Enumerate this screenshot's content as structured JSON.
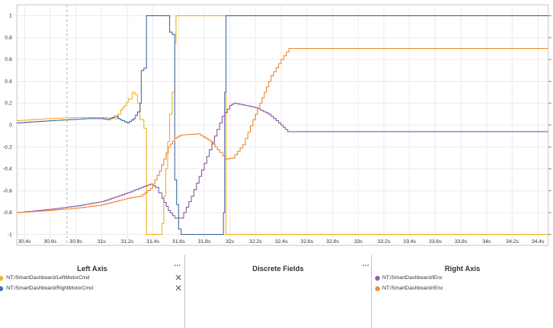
{
  "chart_data": {
    "type": "line",
    "x_unit": "s",
    "xlim": [
      30.34,
      34.48
    ],
    "ylim": [
      -1.1,
      1.1
    ],
    "x_ticks": [
      30.4,
      30.6,
      30.8,
      31,
      31.2,
      31.4,
      31.6,
      31.8,
      32,
      32.2,
      32.4,
      32.6,
      32.8,
      33,
      33.2,
      33.4,
      33.6,
      33.8,
      34,
      34.2,
      34.4
    ],
    "x_tick_labels": [
      "30.4s",
      "30.6s",
      "30.8s",
      "31s",
      "31.2s",
      "31.4s",
      "31.6s",
      "31.8s",
      "32s",
      "32.2s",
      "32.4s",
      "32.6s",
      "32.8s",
      "33s",
      "33.2s",
      "33.4s",
      "33.6s",
      "33.8s",
      "34s",
      "34.2s",
      "34.4s"
    ],
    "y_ticks": [
      1,
      0.8,
      0.6,
      0.4,
      0.2,
      0,
      -0.2,
      -0.4,
      -0.6,
      -0.8,
      -1
    ],
    "y_tick_labels": [
      "1",
      "0.8",
      "0.6",
      "0.4",
      "0.2",
      "0",
      "-0.2",
      "-0.4",
      "-0.6",
      "-0.8",
      "-1"
    ],
    "grid": true,
    "cursor_x": 30.73,
    "series": [
      {
        "name": "NT:/SmartDashboard/LeftMotorCmd",
        "color": "#f0b429",
        "step": true,
        "points": [
          [
            30.34,
            0.04
          ],
          [
            30.6,
            0.06
          ],
          [
            30.8,
            0.07
          ],
          [
            31.0,
            0.07
          ],
          [
            31.1,
            0.06
          ],
          [
            31.15,
            0.14
          ],
          [
            31.18,
            0.18
          ],
          [
            31.21,
            0.24
          ],
          [
            31.24,
            0.3
          ],
          [
            31.26,
            0.28
          ],
          [
            31.28,
            0.2
          ],
          [
            31.3,
            0.05
          ],
          [
            31.33,
            -0.03
          ],
          [
            31.35,
            -1
          ],
          [
            31.46,
            -1
          ],
          [
            31.47,
            -0.9
          ],
          [
            31.5,
            -0.4
          ],
          [
            31.53,
            0.1
          ],
          [
            31.55,
            0.3
          ],
          [
            31.57,
            0.75
          ],
          [
            31.58,
            1
          ],
          [
            31.96,
            1
          ],
          [
            31.97,
            -1
          ],
          [
            34.48,
            -1
          ]
        ]
      },
      {
        "name": "NT:/SmartDashboard/RightMotorCmd",
        "color": "#4a6fa5",
        "step": true,
        "points": [
          [
            30.34,
            0.02
          ],
          [
            30.6,
            0.04
          ],
          [
            30.9,
            0.06
          ],
          [
            31.0,
            0.06
          ],
          [
            31.05,
            0.05
          ],
          [
            31.1,
            0.08
          ],
          [
            31.13,
            0.06
          ],
          [
            31.16,
            0.04
          ],
          [
            31.2,
            0.02
          ],
          [
            31.25,
            0.06
          ],
          [
            31.28,
            0.12
          ],
          [
            31.3,
            0.2
          ],
          [
            31.31,
            0.5
          ],
          [
            31.33,
            0.52
          ],
          [
            31.35,
            1
          ],
          [
            31.52,
            1
          ],
          [
            31.53,
            0.85
          ],
          [
            31.55,
            0.83
          ],
          [
            31.57,
            -0.5
          ],
          [
            31.6,
            -0.95
          ],
          [
            31.62,
            -1
          ],
          [
            31.94,
            -1
          ],
          [
            31.95,
            -0.8
          ],
          [
            31.96,
            0.3
          ],
          [
            31.97,
            1
          ],
          [
            34.48,
            1
          ]
        ]
      },
      {
        "name": "NT:/SmartDashboard/lEnc",
        "color": "#8e5fa8",
        "step": true,
        "points": [
          [
            30.34,
            -0.8
          ],
          [
            30.6,
            -0.77
          ],
          [
            30.8,
            -0.74
          ],
          [
            31.0,
            -0.7
          ],
          [
            31.2,
            -0.62
          ],
          [
            31.33,
            -0.56
          ],
          [
            31.38,
            -0.54
          ],
          [
            31.42,
            -0.57
          ],
          [
            31.47,
            -0.67
          ],
          [
            31.52,
            -0.78
          ],
          [
            31.57,
            -0.85
          ],
          [
            31.62,
            -0.85
          ],
          [
            31.7,
            -0.65
          ],
          [
            31.8,
            -0.35
          ],
          [
            31.88,
            -0.1
          ],
          [
            31.94,
            0.08
          ],
          [
            32.0,
            0.18
          ],
          [
            32.03,
            0.2
          ],
          [
            32.12,
            0.18
          ],
          [
            32.2,
            0.16
          ],
          [
            32.3,
            0.1
          ],
          [
            32.38,
            0.02
          ],
          [
            32.45,
            -0.06
          ],
          [
            32.5,
            -0.06
          ],
          [
            34.48,
            -0.06
          ]
        ]
      },
      {
        "name": "NT:/SmartDashboard/rEnc",
        "color": "#f28c38",
        "step": true,
        "points": [
          [
            30.34,
            -0.8
          ],
          [
            30.6,
            -0.78
          ],
          [
            30.8,
            -0.76
          ],
          [
            31.0,
            -0.73
          ],
          [
            31.2,
            -0.67
          ],
          [
            31.3,
            -0.65
          ],
          [
            31.38,
            -0.58
          ],
          [
            31.45,
            -0.42
          ],
          [
            31.52,
            -0.2
          ],
          [
            31.57,
            -0.12
          ],
          [
            31.62,
            -0.09
          ],
          [
            31.75,
            -0.08
          ],
          [
            31.85,
            -0.15
          ],
          [
            31.92,
            -0.25
          ],
          [
            31.97,
            -0.31
          ],
          [
            32.02,
            -0.3
          ],
          [
            32.1,
            -0.18
          ],
          [
            32.18,
            0.05
          ],
          [
            32.25,
            0.25
          ],
          [
            32.32,
            0.45
          ],
          [
            32.4,
            0.6
          ],
          [
            32.46,
            0.7
          ],
          [
            34.48,
            0.7
          ]
        ]
      }
    ]
  },
  "panels": {
    "left": {
      "title": "Left Axis",
      "more": "···",
      "items": [
        {
          "label": "NT:/SmartDashboard/LeftMotorCmd",
          "color": "#f0b429",
          "remove": "✕"
        },
        {
          "label": "NT:/SmartDashboard/RightMotorCmd",
          "color": "#4a6fa5",
          "remove": "✕"
        }
      ]
    },
    "discrete": {
      "title": "Discrete Fields",
      "more": "···"
    },
    "right": {
      "title": "Right Axis",
      "items": [
        {
          "label": "NT:/SmartDashboard/lEnc",
          "color": "#8e5fa8"
        },
        {
          "label": "NT:/SmartDashboard/rEnc",
          "color": "#f28c38"
        }
      ]
    }
  }
}
